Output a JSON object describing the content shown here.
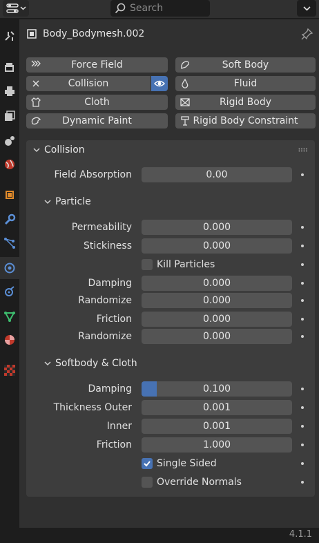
{
  "header": {
    "search_placeholder": "Search"
  },
  "object": {
    "name": "Body_Bodymesh.002"
  },
  "physics_buttons": {
    "force_field": "Force Field",
    "soft_body": "Soft Body",
    "collision": "Collision",
    "fluid": "Fluid",
    "cloth": "Cloth",
    "rigid_body": "Rigid Body",
    "dynamic_paint": "Dynamic Paint",
    "rigid_body_constraint": "Rigid Body Constraint"
  },
  "collision": {
    "title": "Collision",
    "field_absorption": {
      "label": "Field Absorption",
      "value": "0.00"
    },
    "particle": {
      "title": "Particle",
      "permeability": {
        "label": "Permeability",
        "value": "0.000"
      },
      "stickiness": {
        "label": "Stickiness",
        "value": "0.000"
      },
      "kill_particles": {
        "label": "Kill Particles",
        "checked": false
      },
      "damping": {
        "label": "Damping",
        "value": "0.000"
      },
      "damping_randomize": {
        "label": "Randomize",
        "value": "0.000"
      },
      "friction": {
        "label": "Friction",
        "value": "0.000"
      },
      "friction_randomize": {
        "label": "Randomize",
        "value": "0.000"
      }
    },
    "softbody_cloth": {
      "title": "Softbody & Cloth",
      "damping": {
        "label": "Damping",
        "value": "0.100",
        "fraction": 0.1
      },
      "thickness_outer": {
        "label": "Thickness Outer",
        "value": "0.001"
      },
      "inner": {
        "label": "Inner",
        "value": "0.001"
      },
      "friction": {
        "label": "Friction",
        "value": "1.000"
      },
      "single_sided": {
        "label": "Single Sided",
        "checked": true
      },
      "override_normals": {
        "label": "Override Normals",
        "checked": false
      }
    }
  },
  "status": {
    "version": "4.1.1"
  },
  "colors": {
    "accent": "#4772b3",
    "panel_bg": "#303030",
    "subpanel_bg": "#3d3d3d",
    "field_bg": "#545454"
  }
}
